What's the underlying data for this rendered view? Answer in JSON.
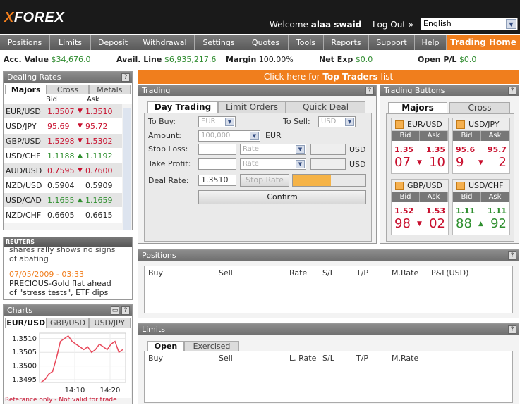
{
  "brand": {
    "logo_x": "X",
    "logo_text": "FOREX",
    "accent": "#f07e1d"
  },
  "header": {
    "welcome_label": "Welcome",
    "user": "alaa swaid",
    "logout": "Log Out »",
    "language": "English"
  },
  "nav": [
    "Positions",
    "Limits",
    "Deposit",
    "Withdrawal",
    "Settings",
    "Quotes",
    "Tools",
    "Reports",
    "Support",
    "Help",
    "Trading Home"
  ],
  "account": {
    "acc_value_label": "Acc. Value",
    "acc_value": "$34,676.0",
    "avail_label": "Avail. Line",
    "avail": "$6,935,217.6",
    "margin_label": "Margin",
    "margin": "100.00%",
    "netexp_label": "Net Exp",
    "netexp": "$0.0",
    "openpl_label": "Open P/L",
    "openpl": "$0.0"
  },
  "dealing": {
    "title": "Dealing Rates",
    "tabs": [
      "Majors",
      "Cross",
      "Metals"
    ],
    "bid": "Bid",
    "ask": "Ask",
    "rows": [
      {
        "pair": "EUR/USD",
        "bid": "1.3507",
        "ask": "1.3510",
        "dir": "down",
        "bg": "#e4e4e4"
      },
      {
        "pair": "USD/JPY",
        "bid": "95.69",
        "ask": "95.72",
        "dir": "down",
        "bg": "#ffffff"
      },
      {
        "pair": "GBP/USD",
        "bid": "1.5298",
        "ask": "1.5302",
        "dir": "down",
        "bg": "#e4e4e4"
      },
      {
        "pair": "USD/CHF",
        "bid": "1.1188",
        "ask": "1.1192",
        "dir": "up",
        "bg": "#ffffff"
      },
      {
        "pair": "AUD/USD",
        "bid": "0.7595",
        "ask": "0.7600",
        "dir": "down",
        "bg": "#e4e4e4"
      },
      {
        "pair": "NZD/USD",
        "bid": "0.5904",
        "ask": "0.5909",
        "dir": "none",
        "bg": "#ffffff"
      },
      {
        "pair": "USD/CAD",
        "bid": "1.1655",
        "ask": "1.1659",
        "dir": "up",
        "bg": "#e4e4e4"
      },
      {
        "pair": "NZD/CHF",
        "bid": "0.6605",
        "ask": "0.6615",
        "dir": "none",
        "bg": "#ffffff"
      }
    ]
  },
  "reuters": {
    "brand": "REUTERS",
    "item1": "shares rally shows no signs",
    "item1b": "of abating",
    "date2": "07/05/2009 - 03:33",
    "item2": "PRECIOUS-Gold flat ahead",
    "item2b": "of \"stress tests\", ETF dips"
  },
  "charts": {
    "title": "Charts",
    "tabs": [
      "EUR/USD",
      "GBP/USD",
      "USD/JPY"
    ],
    "note": "Referance only - Not valid for trade"
  },
  "chart_data": {
    "type": "line",
    "y_ticks": [
      "1.3510",
      "1.3505",
      "1.3500",
      "1.3495"
    ],
    "x_ticks": [
      "14:10",
      "14:20"
    ],
    "ylim": [
      1.3494,
      1.3512
    ],
    "values": [
      1.3494,
      1.3495,
      1.3497,
      1.3498,
      1.3503,
      1.3509,
      1.351,
      1.3511,
      1.3509,
      1.3508,
      1.3507,
      1.3506,
      1.3507,
      1.3505,
      1.3506,
      1.3508,
      1.3507,
      1.3506,
      1.3508,
      1.3509,
      1.3505,
      1.3506
    ]
  },
  "banner": {
    "pre": "Click here for",
    "bold": "Top Traders",
    "post": "list"
  },
  "trading": {
    "title": "Trading",
    "tabs": [
      "Day Trading",
      "Limit Orders",
      "Quick Deal"
    ],
    "to_buy": "To Buy:",
    "buy_val": "EUR",
    "to_sell": "To Sell:",
    "sell_val": "USD",
    "amount": "Amount:",
    "amount_val": "100,000",
    "amount_ccy": "EUR",
    "stop_loss": "Stop Loss:",
    "rate": "Rate",
    "usd": "USD",
    "take_profit": "Take Profit:",
    "deal_rate": "Deal Rate:",
    "deal_rate_val": "1.3510",
    "stop_rate": "Stop Rate",
    "confirm": "Confirm"
  },
  "trading_buttons": {
    "title": "Trading Buttons",
    "tabs": [
      "Majors",
      "Cross"
    ],
    "bid": "Bid",
    "ask": "Ask",
    "cards": [
      {
        "pair": "EUR/USD",
        "sbid": "1.35",
        "sask": "1.35",
        "bbid": "07",
        "bask": "10",
        "dir": "down"
      },
      {
        "pair": "USD/JPY",
        "sbid": "95.6",
        "sask": "95.7",
        "bbid": "9",
        "bask": "2",
        "dir": "down"
      },
      {
        "pair": "GBP/USD",
        "sbid": "1.52",
        "sask": "1.53",
        "bbid": "98",
        "bask": "02",
        "dir": "down"
      },
      {
        "pair": "USD/CHF",
        "sbid": "1.11",
        "sask": "1.11",
        "bbid": "88",
        "bask": "92",
        "dir": "up"
      }
    ]
  },
  "positions": {
    "title": "Positions",
    "cols": [
      "Buy",
      "Sell",
      "Rate",
      "S/L",
      "T/P",
      "M.Rate",
      "P&L(USD)"
    ]
  },
  "limits": {
    "title": "Limits",
    "tabs": [
      "Open",
      "Exercised"
    ],
    "cols": [
      "Buy",
      "Sell",
      "L. Rate",
      "S/L",
      "T/P",
      "M.Rate"
    ]
  }
}
